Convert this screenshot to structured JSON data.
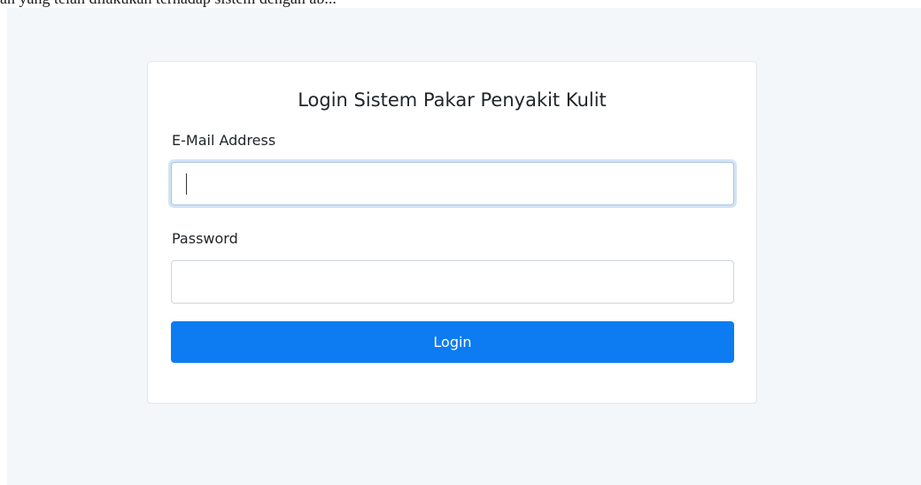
{
  "page_top_text": "an yang telah dilakukan terhadap sistem dengan ab...",
  "login_form": {
    "title": "Login Sistem Pakar Penyakit Kulit",
    "email": {
      "label": "E-Mail Address",
      "value": "",
      "placeholder": ""
    },
    "password": {
      "label": "Password",
      "value": "",
      "placeholder": ""
    },
    "submit_label": "Login"
  },
  "colors": {
    "page_background": "#f4f7fa",
    "card_background": "#ffffff",
    "primary_button": "#0d7cf2",
    "focus_ring": "#a9c7e4"
  }
}
